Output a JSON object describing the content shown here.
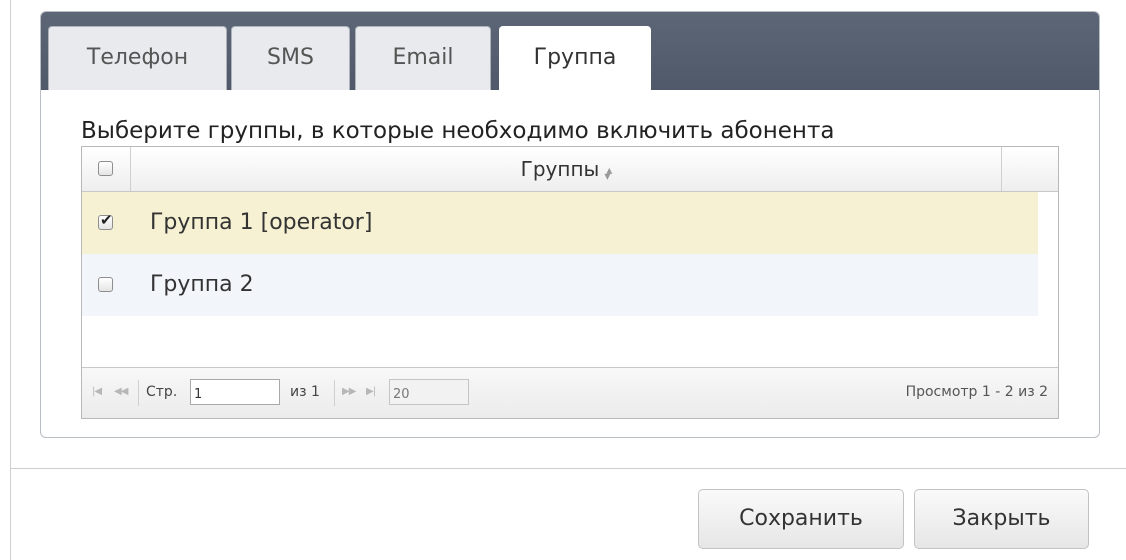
{
  "tabs": [
    {
      "label": "Телефон",
      "active": false
    },
    {
      "label": "SMS",
      "active": false
    },
    {
      "label": "Email",
      "active": false
    },
    {
      "label": "Группа",
      "active": true
    }
  ],
  "instructions": "Выберите группы, в которые необходимо включить абонента",
  "grid": {
    "header": {
      "title": "Группы",
      "sort_icon": "sort-icon",
      "select_all_checked": false
    },
    "rows": [
      {
        "label": "Группа 1 [operator]",
        "checked": true
      },
      {
        "label": "Группа 2",
        "checked": false
      }
    ],
    "pager": {
      "page_label": "Стр.",
      "page_value": "1",
      "of_text": "из 1",
      "page_size": "20",
      "view_text": "Просмотр 1 - 2 из 2",
      "icons": [
        "first-page-icon",
        "prev-page-icon",
        "next-page-icon",
        "last-page-icon"
      ]
    }
  },
  "footer": {
    "save_label": "Сохранить",
    "close_label": "Закрыть"
  }
}
